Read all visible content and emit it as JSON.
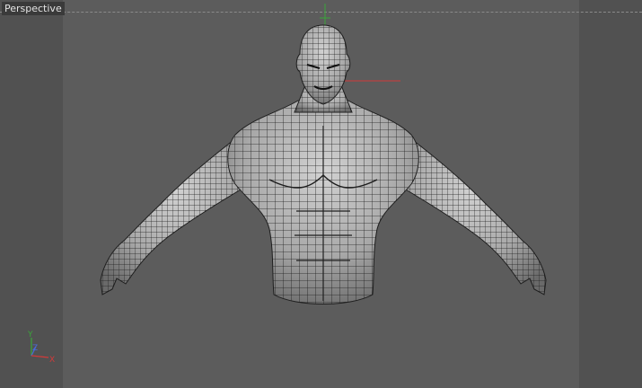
{
  "viewport": {
    "label": "Perspective"
  },
  "axis_gizmo": {
    "y_label": "Y",
    "z_label": "Z",
    "x_label": "X"
  },
  "colors": {
    "axis_x": "#d23a3a",
    "axis_y": "#3aa63a",
    "axis_z": "#4a6ad8",
    "mesh_fill": "#a9a9a9",
    "wire": "#1e1e1e"
  }
}
